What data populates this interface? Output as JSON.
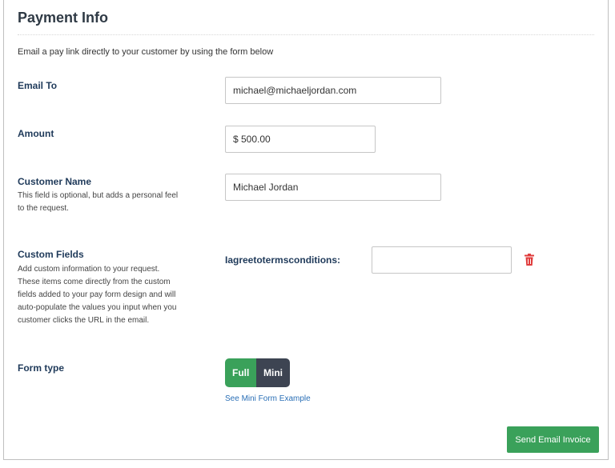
{
  "header": {
    "title": "Payment Info",
    "intro": "Email a pay link directly to your customer by using the form below"
  },
  "email_to": {
    "label": "Email To",
    "value": "michael@michaeljordan.com"
  },
  "amount": {
    "label": "Amount",
    "value": "$ 500.00"
  },
  "customer_name": {
    "label": "Customer Name",
    "help_line1": "This field is optional, but adds a personal feel",
    "help_line2": "to the request.",
    "value": "Michael Jordan"
  },
  "custom_fields": {
    "label": "Custom Fields",
    "help_lines": [
      "Add custom information to your request.",
      "These items come directly from the custom",
      "fields added to your pay form design and will",
      "auto-populate the values you input when you",
      "customer clicks the URL in the email."
    ],
    "field_label": "Iagreetotermsconditions:",
    "field_value": "",
    "delete_icon": "trash-icon",
    "delete_color": "#e03c3c"
  },
  "form_type": {
    "label": "Form type",
    "options": [
      "Full",
      "Mini"
    ],
    "selected": "Full",
    "example_link": "See Mini Form Example"
  },
  "actions": {
    "send_label": "Send Email Invoice"
  },
  "colors": {
    "accent_green": "#3aa15a",
    "dark_toggle": "#3d4452",
    "label_blue": "#1f3a5a",
    "link_blue": "#2a6fb6"
  }
}
